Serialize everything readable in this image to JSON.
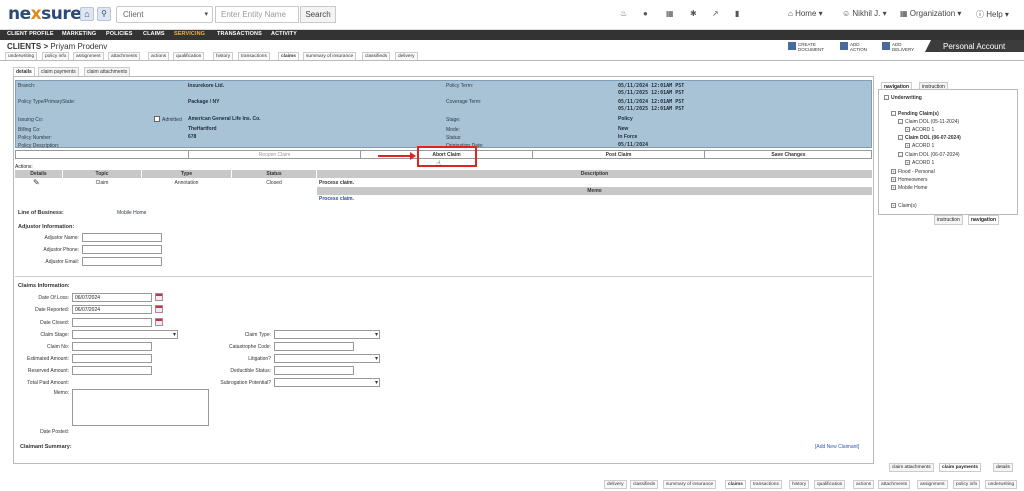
{
  "topbar": {
    "logo_main": "ne",
    "logo_x": "x",
    "logo_rest": "sure",
    "entity_select": "Client",
    "entity_placeholder": "Enter Entity Name",
    "search_button": "Search",
    "home_menu": "Home",
    "user_menu": "Nikhil J.",
    "org_menu": "Organization",
    "help_menu": "Help"
  },
  "mainnav": [
    "CLIENT PROFILE",
    "MARKETING",
    "POLICIES",
    "CLAIMS",
    "SERVICING",
    "TRANSACTIONS",
    "ACTIVITY"
  ],
  "title": {
    "prefix": "CLIENTS > ",
    "name": "Priyam Prodenv"
  },
  "subtabs": [
    "underwriting",
    "policy info",
    "assignment",
    "attachments",
    "actions",
    "qualification",
    "history",
    "transactions",
    "claims",
    "summary of insurance",
    "classifieds",
    "delivery"
  ],
  "actions_top": {
    "create_doc": [
      "CREATE",
      "DOCUMENT"
    ],
    "add_action": [
      "ADD",
      "ACTION"
    ],
    "add_delivery": [
      "ADD",
      "DELIVERY"
    ]
  },
  "personal_account": "Personal Account",
  "detail_tabs": [
    "details",
    "claim payments",
    "claim attachments"
  ],
  "info": {
    "branch_lbl": "Branch:",
    "branch_val": "Insurekore Ltd.",
    "ptype_lbl": "Policy Type/PrimaryState:",
    "ptype_val": "Package / NY",
    "issuing_lbl": "Issuing Co:",
    "admitted_lbl": "Admitted",
    "issuing_val": "American General Life Ins. Co.",
    "billing_lbl": "Billing Co:",
    "billing_val": "TheHartford",
    "pnum_lbl": "Policy Number:",
    "pnum_val": "678",
    "pdesc_lbl": "Policy Description:",
    "term_lbl": "Policy Term:",
    "term_1": "05/11/2024  12:01AM PST",
    "term_2": "05/11/2025  12:01AM PST",
    "cov_lbl": "Coverage Term:",
    "cov_1": "05/11/2024  12:01AM PST",
    "cov_2": "05/11/2025  12:01AM PST",
    "stage_lbl": "Stage:",
    "stage_val": "Policy",
    "mode_lbl": "Mode:",
    "mode_val": "New",
    "status_lbl": "Status:",
    "status_val": "In Force",
    "orig_lbl": "Origination Date:",
    "orig_val": "05/11/2024"
  },
  "buttons": {
    "reopen": "Reopen Claim",
    "abort": "Abort Claim",
    "post": "Post Claim",
    "save": "Save Changes"
  },
  "actions_table": {
    "label": "Actions:",
    "headers": [
      "Details",
      "Topic",
      "Type",
      "Status",
      "Description"
    ],
    "memo_header": "Memo",
    "row": {
      "topic": "Claim",
      "type": "Annotation",
      "status": "Closed",
      "description": "Process claim.",
      "memo": "Process claim."
    }
  },
  "lob": {
    "label": "Line of Business:",
    "value": "Mobile Home"
  },
  "adjustor": {
    "title": "Adjustor Information:",
    "name": "Adjustor Name:",
    "phone": "Adjustor Phone:",
    "email": "Adjustor Email:"
  },
  "claims": {
    "title": "Claims Information:",
    "dol_lbl": "Date Of Loss:",
    "dol_val": "06/07/2024",
    "rep_lbl": "Date Reported:",
    "rep_val": "06/07/2024",
    "closed_lbl": "Date Closed:",
    "stage_lbl": "Claim Stage:",
    "no_lbl": "Claim No:",
    "est_lbl": "Estimated Amount:",
    "res_lbl": "Reserved Amount:",
    "paid_lbl": "Total Paid Amount:",
    "memo_lbl": "Memo:",
    "posted_lbl": "Date Posted:",
    "type_lbl": "Claim Type:",
    "cat_lbl": "Catastrophe Code:",
    "lit_lbl": "Litigation?",
    "ded_lbl": "Deductible Status:",
    "sub_lbl": "Subrogation Potential?"
  },
  "claimant": {
    "title": "Claimant Summary:",
    "add_link": "[Add New Claimant]"
  },
  "right": {
    "tabs": [
      "navigation",
      "instruction"
    ],
    "tree": {
      "root": "Underwriting",
      "pending": "Pending Claim(s)",
      "c1": "Claim DOL (05-11-2024)",
      "acord": "ACORD 1",
      "c2": "Claim DOL (06-07-2024)",
      "c3": "Claim DOL (06-07-2024)",
      "flood": "Flood - Personal",
      "home": "Homeowners",
      "mobile": "Mobile Home",
      "claims": "Claim(s)"
    },
    "bottom_tabs": [
      "instruction",
      "navigation"
    ]
  },
  "bottom_tabs": [
    "claim attachments",
    "claim payments",
    "details"
  ],
  "footer_tabs": [
    "delivery",
    "classifieds",
    "summary of insurance",
    "claims",
    "transactions",
    "history",
    "qualification",
    "actions",
    "attachments",
    "assignment",
    "policy info",
    "underwriting"
  ]
}
